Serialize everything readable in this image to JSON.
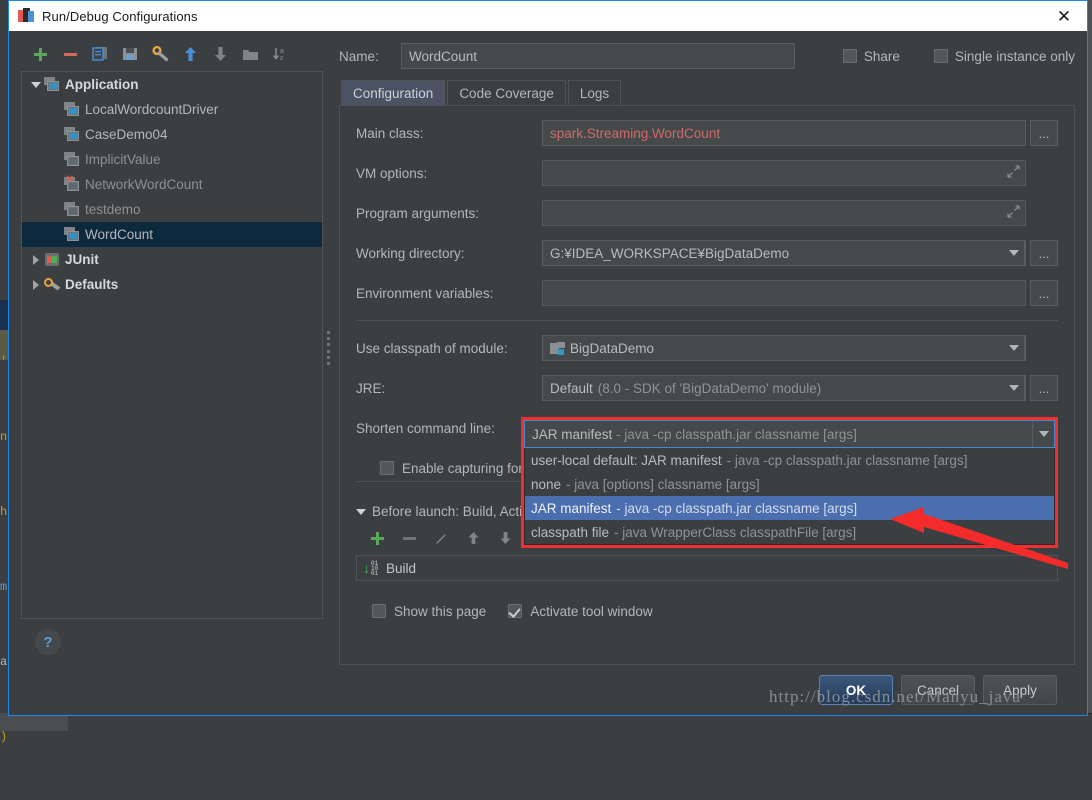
{
  "window": {
    "title": "Run/Debug Configurations",
    "close_label": "✕",
    "app_icon": "idea-logo-icon"
  },
  "tree_toolbar": {
    "buttons": [
      {
        "name": "add-configuration-button",
        "icon": "plus-icon",
        "tooltip": "Add New Configuration"
      },
      {
        "name": "remove-configuration-button",
        "icon": "minus-icon",
        "tooltip": "Remove Configuration"
      },
      {
        "name": "copy-configuration-button",
        "icon": "copy-icon",
        "tooltip": "Copy Configuration"
      },
      {
        "name": "save-configuration-button",
        "icon": "save-icon",
        "tooltip": "Save Configuration"
      },
      {
        "name": "edit-defaults-button",
        "icon": "wrench-icon",
        "tooltip": "Edit defaults"
      },
      {
        "name": "move-up-button",
        "icon": "arrow-up-icon",
        "tooltip": "Move Up"
      },
      {
        "name": "move-down-button",
        "icon": "arrow-down-icon",
        "tooltip": "Move Down"
      },
      {
        "name": "create-folder-button",
        "icon": "folder-icon",
        "tooltip": "Create New Folder"
      },
      {
        "name": "sort-button",
        "icon": "sort-az-icon",
        "tooltip": "Sort Configurations"
      }
    ]
  },
  "tree": {
    "nodes": [
      {
        "label": "Application",
        "level": 0,
        "state": "expanded",
        "icon": "application-icon",
        "bold": true,
        "dim": false,
        "selected": false,
        "error": false
      },
      {
        "label": "LocalWordcountDriver",
        "level": 1,
        "state": "leaf",
        "icon": "application-icon",
        "bold": false,
        "dim": false,
        "selected": false,
        "error": false
      },
      {
        "label": "CaseDemo04",
        "level": 1,
        "state": "leaf",
        "icon": "application-icon",
        "bold": false,
        "dim": false,
        "selected": false,
        "error": false
      },
      {
        "label": "ImplicitValue",
        "level": 1,
        "state": "leaf",
        "icon": "application-icon",
        "bold": false,
        "dim": true,
        "selected": false,
        "error": false
      },
      {
        "label": "NetworkWordCount",
        "level": 1,
        "state": "leaf",
        "icon": "application-icon",
        "bold": false,
        "dim": true,
        "selected": false,
        "error": true
      },
      {
        "label": "testdemo",
        "level": 1,
        "state": "leaf",
        "icon": "application-icon",
        "bold": false,
        "dim": true,
        "selected": false,
        "error": false
      },
      {
        "label": "WordCount",
        "level": 1,
        "state": "leaf",
        "icon": "application-icon",
        "bold": false,
        "dim": false,
        "selected": true,
        "error": false
      },
      {
        "label": "JUnit",
        "level": 0,
        "state": "collapsed",
        "icon": "junit-icon",
        "bold": true,
        "dim": false,
        "selected": false,
        "error": false
      },
      {
        "label": "Defaults",
        "level": 0,
        "state": "collapsed",
        "icon": "defaults-wrench-icon",
        "bold": true,
        "dim": false,
        "selected": false,
        "error": false
      }
    ]
  },
  "help": {
    "label": "?"
  },
  "name_field": {
    "label": "Name:",
    "value": "WordCount",
    "placeholder": ""
  },
  "top_checks": [
    {
      "name": "share-checkbox",
      "label": "Share",
      "checked": false
    },
    {
      "name": "single-instance-checkbox",
      "label": "Single instance only",
      "checked": false
    }
  ],
  "tabs": [
    {
      "label": "Configuration",
      "active": true
    },
    {
      "label": "Code Coverage",
      "active": false
    },
    {
      "label": "Logs",
      "active": false
    }
  ],
  "form": {
    "main_class": {
      "label": "Main class:",
      "value": "spark.Streaming.WordCount",
      "error": true,
      "browse_label": "..."
    },
    "vm_options": {
      "label": "VM options:",
      "value": "",
      "expand_icon": "expand-arrows-icon"
    },
    "program_arguments": {
      "label": "Program arguments:",
      "value": "",
      "expand_icon": "expand-arrows-icon"
    },
    "working_directory": {
      "label": "Working directory:",
      "value": "G:¥IDEA_WORKSPACE¥BigDataDemo",
      "browse_label": "..."
    },
    "environment_variables": {
      "label": "Environment variables:",
      "value": "",
      "browse_label": "..."
    },
    "use_classpath_of_module": {
      "label": "Use classpath of module:",
      "value": "BigDataDemo",
      "icon": "module-icon"
    },
    "jre": {
      "label": "JRE:",
      "value": "Default",
      "value_detail": "(8.0 - SDK of 'BigDataDemo' module)",
      "browse_label": "..."
    },
    "shorten_command_line": {
      "label": "Shorten command line:",
      "value_main": "JAR manifest",
      "value_detail": "- java -cp classpath.jar classname [args]"
    },
    "enable_capturing": {
      "label": "Enable capturing form snapshots",
      "checked": false
    }
  },
  "dropdown": {
    "open": true,
    "highlight_color": "#f03030",
    "selection_color": "#4b6eaf",
    "items": [
      {
        "main": "user-local default: JAR manifest",
        "detail": "- java -cp classpath.jar classname [args]",
        "selected": false
      },
      {
        "main": "none",
        "detail": "- java [options] classname [args]",
        "selected": false
      },
      {
        "main": "JAR manifest",
        "detail": "- java -cp classpath.jar classname [args]",
        "selected": true
      },
      {
        "main": "classpath file",
        "detail": "- java WrapperClass classpathFile [args]",
        "selected": false
      }
    ]
  },
  "before_launch": {
    "header": "Before launch: Build, Activate tool window",
    "toolbar": [
      {
        "name": "bl-add-button",
        "icon": "plus-icon"
      },
      {
        "name": "bl-remove-button",
        "icon": "minus-icon"
      },
      {
        "name": "bl-edit-button",
        "icon": "pencil-icon"
      },
      {
        "name": "bl-move-up-button",
        "icon": "arrow-up-icon"
      },
      {
        "name": "bl-move-down-button",
        "icon": "arrow-down-icon"
      }
    ],
    "items": [
      {
        "label": "Build",
        "icon": "build-icon"
      }
    ]
  },
  "bottom_checks": [
    {
      "name": "show-this-page-checkbox",
      "label": "Show this page",
      "checked": false
    },
    {
      "name": "activate-tool-window-checkbox",
      "label": "Activate tool window",
      "checked": true
    }
  ],
  "footer": {
    "ok": "OK",
    "cancel": "Cancel",
    "apply": "Apply"
  },
  "watermark": "http://blog.csdn.net/Manyu_java",
  "background_code": {
    "lines": [
      "'a",
      "n",
      "h",
      "m",
      "a",
      ")"
    ]
  }
}
